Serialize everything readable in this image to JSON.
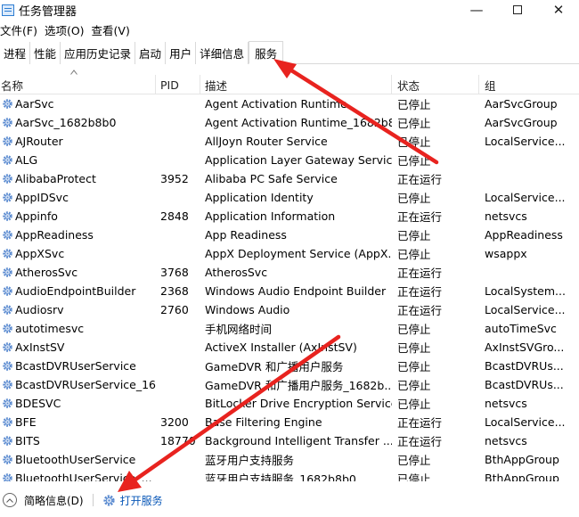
{
  "window": {
    "title": "任务管理器"
  },
  "menu": [
    "文件(F)",
    "选项(O)",
    "查看(V)"
  ],
  "tabs": [
    {
      "label": "进程",
      "active": false
    },
    {
      "label": "性能",
      "active": false
    },
    {
      "label": "应用历史记录",
      "active": false
    },
    {
      "label": "启动",
      "active": false
    },
    {
      "label": "用户",
      "active": false
    },
    {
      "label": "详细信息",
      "active": false
    },
    {
      "label": "服务",
      "active": true
    }
  ],
  "columns": {
    "name": "名称",
    "pid": "PID",
    "desc": "描述",
    "status": "状态",
    "group": "组"
  },
  "services": [
    {
      "name": "AarSvc",
      "pid": "",
      "desc": "Agent Activation Runtime",
      "status": "已停止",
      "group": "AarSvcGroup"
    },
    {
      "name": "AarSvc_1682b8b0",
      "pid": "",
      "desc": "Agent Activation Runtime_1682b8...",
      "status": "已停止",
      "group": "AarSvcGroup"
    },
    {
      "name": "AJRouter",
      "pid": "",
      "desc": "AllJoyn Router Service",
      "status": "已停止",
      "group": "LocalService..."
    },
    {
      "name": "ALG",
      "pid": "",
      "desc": "Application Layer Gateway Service",
      "status": "已停止",
      "group": ""
    },
    {
      "name": "AlibabaProtect",
      "pid": "3952",
      "desc": "Alibaba PC Safe Service",
      "status": "正在运行",
      "group": ""
    },
    {
      "name": "AppIDSvc",
      "pid": "",
      "desc": "Application Identity",
      "status": "已停止",
      "group": "LocalService..."
    },
    {
      "name": "Appinfo",
      "pid": "2848",
      "desc": "Application Information",
      "status": "正在运行",
      "group": "netsvcs"
    },
    {
      "name": "AppReadiness",
      "pid": "",
      "desc": "App Readiness",
      "status": "已停止",
      "group": "AppReadiness"
    },
    {
      "name": "AppXSvc",
      "pid": "",
      "desc": "AppX Deployment Service (AppX...",
      "status": "已停止",
      "group": "wsappx"
    },
    {
      "name": "AtherosSvc",
      "pid": "3768",
      "desc": "AtherosSvc",
      "status": "正在运行",
      "group": ""
    },
    {
      "name": "AudioEndpointBuilder",
      "pid": "2368",
      "desc": "Windows Audio Endpoint Builder",
      "status": "正在运行",
      "group": "LocalSystem..."
    },
    {
      "name": "Audiosrv",
      "pid": "2760",
      "desc": "Windows Audio",
      "status": "正在运行",
      "group": "LocalService..."
    },
    {
      "name": "autotimesvc",
      "pid": "",
      "desc": "手机网络时间",
      "status": "已停止",
      "group": "autoTimeSvc"
    },
    {
      "name": "AxInstSV",
      "pid": "",
      "desc": "ActiveX Installer (AxInstSV)",
      "status": "已停止",
      "group": "AxInstSVGro..."
    },
    {
      "name": "BcastDVRUserService",
      "pid": "",
      "desc": "GameDVR 和广播用户服务",
      "status": "已停止",
      "group": "BcastDVRUs..."
    },
    {
      "name": "BcastDVRUserService_16...",
      "pid": "",
      "desc": "GameDVR 和广播用户服务_1682b...",
      "status": "已停止",
      "group": "BcastDVRUs..."
    },
    {
      "name": "BDESVC",
      "pid": "",
      "desc": "BitLocker Drive Encryption Service",
      "status": "已停止",
      "group": "netsvcs"
    },
    {
      "name": "BFE",
      "pid": "3200",
      "desc": "Base Filtering Engine",
      "status": "正在运行",
      "group": "LocalService..."
    },
    {
      "name": "BITS",
      "pid": "18770",
      "desc": "Background Intelligent Transfer ...",
      "status": "正在运行",
      "group": "netsvcs"
    },
    {
      "name": "BluetoothUserService",
      "pid": "",
      "desc": "蓝牙用户支持服务",
      "status": "已停止",
      "group": "BthAppGroup"
    },
    {
      "name": "BluetoothUserService_...",
      "pid": "",
      "desc": "蓝牙用户支持服务_1682b8b0",
      "status": "已停止",
      "group": "BthAppGroup"
    }
  ],
  "footer": {
    "details": "简略信息(D)",
    "open_services": "打开服务"
  },
  "icons": {
    "service": "gear-icon",
    "collapse": "chevron-up-icon",
    "app": "task-manager-icon"
  },
  "colors": {
    "accent_link": "#0a58b8",
    "gear": "#5b8bd0",
    "annotation_arrow": "#e8231f"
  }
}
